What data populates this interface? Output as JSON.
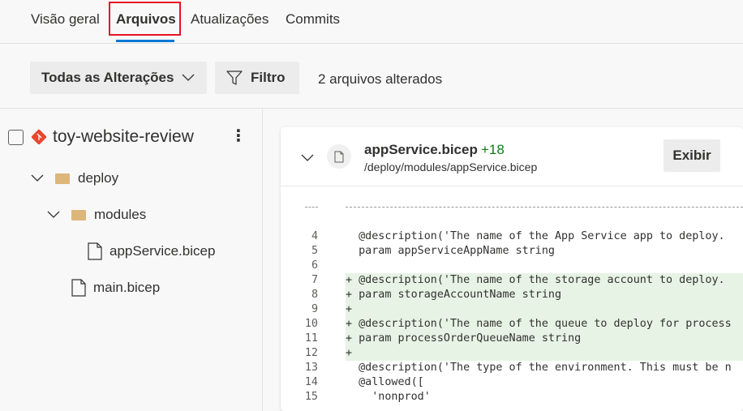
{
  "tabs": [
    {
      "label": "Visão geral",
      "active": false
    },
    {
      "label": "Arquivos",
      "active": true
    },
    {
      "label": "Atualizações",
      "active": false
    },
    {
      "label": "Commits",
      "active": false
    }
  ],
  "toolbar": {
    "changes_dropdown": "Todas as Alterações",
    "filter_label": "Filtro",
    "files_changed": "2 arquivos alterados"
  },
  "tree": {
    "repo": "toy-website-review",
    "items": [
      {
        "type": "folder",
        "label": "deploy",
        "expanded": true
      },
      {
        "type": "folder",
        "label": "modules",
        "expanded": true
      },
      {
        "type": "file",
        "label": "appService.bicep"
      },
      {
        "type": "file",
        "label": "main.bicep"
      }
    ]
  },
  "diff": {
    "file_name": "appService.bicep",
    "added_count": "+18",
    "file_path": "/deploy/modules/appService.bicep",
    "view_label": "Exibir",
    "lines": [
      {
        "num": "4",
        "text": "  @description('The name of the App Service app to deploy.",
        "added": false
      },
      {
        "num": "5",
        "text": "  param appServiceAppName string",
        "added": false
      },
      {
        "num": "6",
        "text": "",
        "added": false
      },
      {
        "num": "7",
        "text": "+ @description('The name of the storage account to deploy.",
        "added": true
      },
      {
        "num": "8",
        "text": "+ param storageAccountName string",
        "added": true
      },
      {
        "num": "9",
        "text": "+",
        "added": true
      },
      {
        "num": "10",
        "text": "+ @description('The name of the queue to deploy for process",
        "added": true
      },
      {
        "num": "11",
        "text": "+ param processOrderQueueName string",
        "added": true
      },
      {
        "num": "12",
        "text": "+",
        "added": true
      },
      {
        "num": "13",
        "text": "  @description('The type of the environment. This must be n",
        "added": false
      },
      {
        "num": "14",
        "text": "  @allowed([",
        "added": false
      },
      {
        "num": "15",
        "text": "    'nonprod'",
        "added": false
      }
    ]
  },
  "colors": {
    "accent": "#0078d4",
    "highlight_box": "#e81123",
    "added_text": "#107c10",
    "added_bg": "#e7f3e5",
    "folder": "#dcb67a",
    "git_icon": "#e8472f"
  }
}
